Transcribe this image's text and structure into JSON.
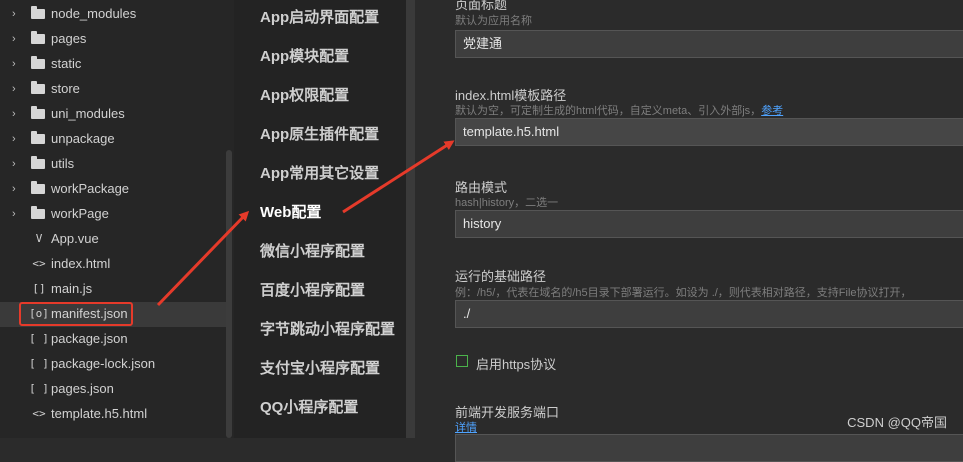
{
  "tree": {
    "items": [
      {
        "type": "folder",
        "label": "node_modules"
      },
      {
        "type": "folder",
        "label": "pages"
      },
      {
        "type": "folder",
        "label": "static"
      },
      {
        "type": "folder",
        "label": "store"
      },
      {
        "type": "folder",
        "label": "uni_modules"
      },
      {
        "type": "folder",
        "label": "unpackage"
      },
      {
        "type": "folder",
        "label": "utils"
      },
      {
        "type": "folder",
        "label": "workPackage"
      },
      {
        "type": "folder",
        "label": "workPage"
      },
      {
        "type": "file",
        "icon": "V",
        "label": "App.vue"
      },
      {
        "type": "file",
        "icon": "<>",
        "label": "index.html"
      },
      {
        "type": "file",
        "icon": "[]",
        "label": "main.js"
      },
      {
        "type": "file",
        "icon": "[o]",
        "label": "manifest.json",
        "selected": true
      },
      {
        "type": "file",
        "icon": "[ ]",
        "label": "package.json"
      },
      {
        "type": "file",
        "icon": "[ ]",
        "label": "package-lock.json"
      },
      {
        "type": "file",
        "icon": "[ ]",
        "label": "pages.json"
      },
      {
        "type": "file",
        "icon": "<>",
        "label": "template.h5.html"
      }
    ]
  },
  "nav": {
    "items": [
      "App启动界面配置",
      "App模块配置",
      "App权限配置",
      "App原生插件配置",
      "App常用其它设置",
      "Web配置",
      "微信小程序配置",
      "百度小程序配置",
      "字节跳动小程序配置",
      "支付宝小程序配置",
      "QQ小程序配置"
    ],
    "active": "Web配置"
  },
  "form": {
    "page_title_label": "页面标题",
    "page_title_hint": "默认为应用名称",
    "page_title_value": "党建通",
    "template_label": "index.html模板路径",
    "template_hint": "默认为空，可定制生成的html代码，自定义meta、引入外部js，",
    "template_hint_link": "参考",
    "template_value": "template.h5.html",
    "router_label": "路由模式",
    "router_hint": "hash|history，二选一",
    "router_value": "history",
    "base_label": "运行的基础路径",
    "base_hint": "例：/h5/，代表在域名的/h5目录下部署运行。如设为 ./，则代表相对路径，支持File协议打开，",
    "base_value": "./",
    "https_label": "启用https协议",
    "port_label": "前端开发服务端口",
    "port_link": "详情"
  },
  "watermark": "CSDN @QQ帝国",
  "colors": {
    "annotation_red": "#e53a2a",
    "link_blue": "#4fa3ff",
    "checkbox_green": "#4bb34b"
  }
}
